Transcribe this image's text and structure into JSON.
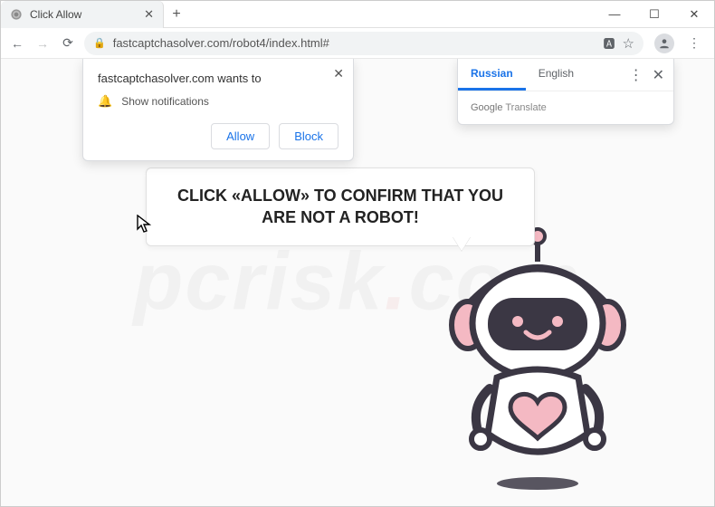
{
  "window": {
    "tab_title": "Click Allow",
    "url": "fastcaptchasolver.com/robot4/index.html#"
  },
  "permission_popup": {
    "wants_to": "fastcaptchasolver.com wants to",
    "permission": "Show notifications",
    "allow_label": "Allow",
    "block_label": "Block"
  },
  "translate_popup": {
    "tab_active": "Russian",
    "tab_other": "English",
    "provider_prefix": "Google",
    "provider_suffix": " Translate"
  },
  "speech_bubble": {
    "text": "CLICK «ALLOW» TO CONFIRM THAT YOU ARE NOT A ROBOT!"
  },
  "watermark": {
    "part1": "pcrisk",
    "part2": ".",
    "part3": "com"
  },
  "icons": {
    "minimize": "—",
    "maximize": "☐",
    "close": "✕",
    "back": "←",
    "forward": "→",
    "reload": "⟳",
    "lock": "🔒",
    "translate": "🅰",
    "star": "☆",
    "menu": "⋮",
    "bell": "🔔",
    "plus": "+",
    "tab_close": "✕",
    "perm_close": "✕",
    "tr_close": "✕"
  }
}
